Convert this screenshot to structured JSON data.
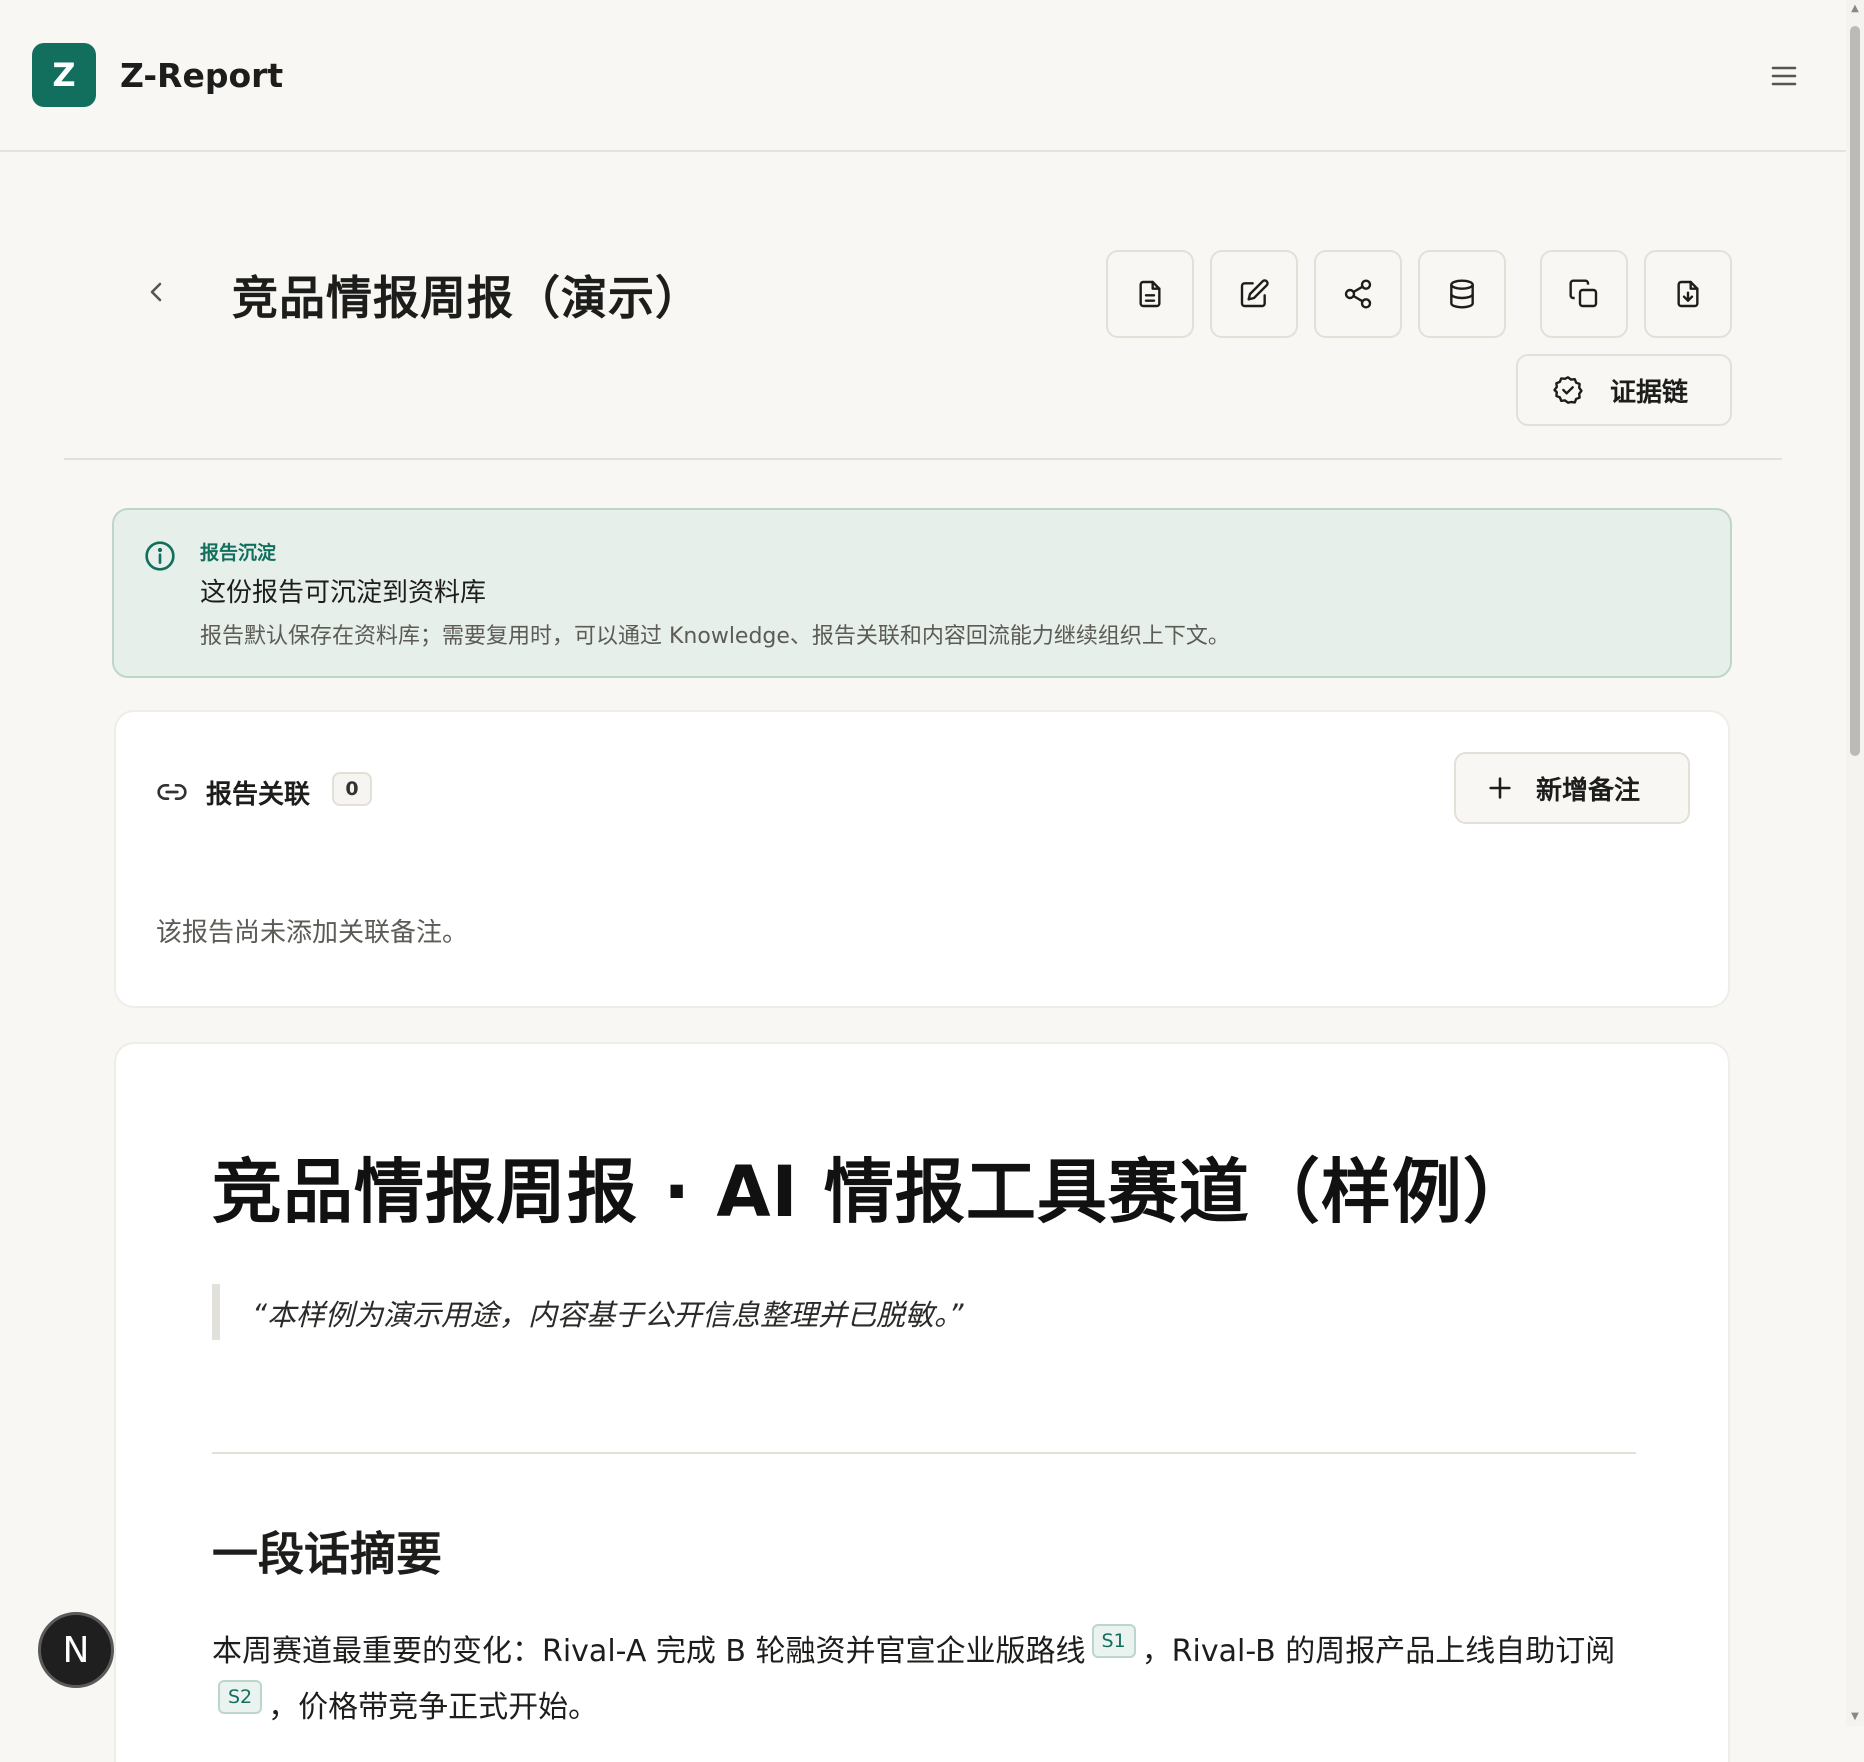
{
  "app": {
    "logo_letter": "Z",
    "name": "Z-Report"
  },
  "page": {
    "title": "竞品情报周报（演示）",
    "evidence_label": "证据链"
  },
  "banner": {
    "kicker": "报告沉淀",
    "title": "这份报告可沉淀到资料库",
    "description": "报告默认保存在资料库；需要复用时，可以通过 Knowledge、报告关联和内容回流能力继续组织上下文。"
  },
  "links": {
    "title": "报告关联",
    "count": "0",
    "add_label": "新增备注",
    "empty_text": "该报告尚未添加关联备注。"
  },
  "report": {
    "title": "竞品情报周报 · AI 情报工具赛道（样例）",
    "quote": "“本样例为演示用途，内容基于公开信息整理并已脱敏。”",
    "section_heading": "一段话摘要",
    "summary_part1": "本周赛道最重要的变化：Rival-A 完成 B 轮融资并官宣企业版路线",
    "cite1": "S1",
    "summary_part2": "，Rival-B 的周报产品上线自助订阅",
    "cite2": "S2",
    "summary_part3": "，价格带竞争正式开始。"
  },
  "fab": {
    "letter": "N"
  },
  "colors": {
    "brand": "#136f5d",
    "banner_bg": "#e7efeb",
    "page_bg": "#f8f7f3"
  }
}
